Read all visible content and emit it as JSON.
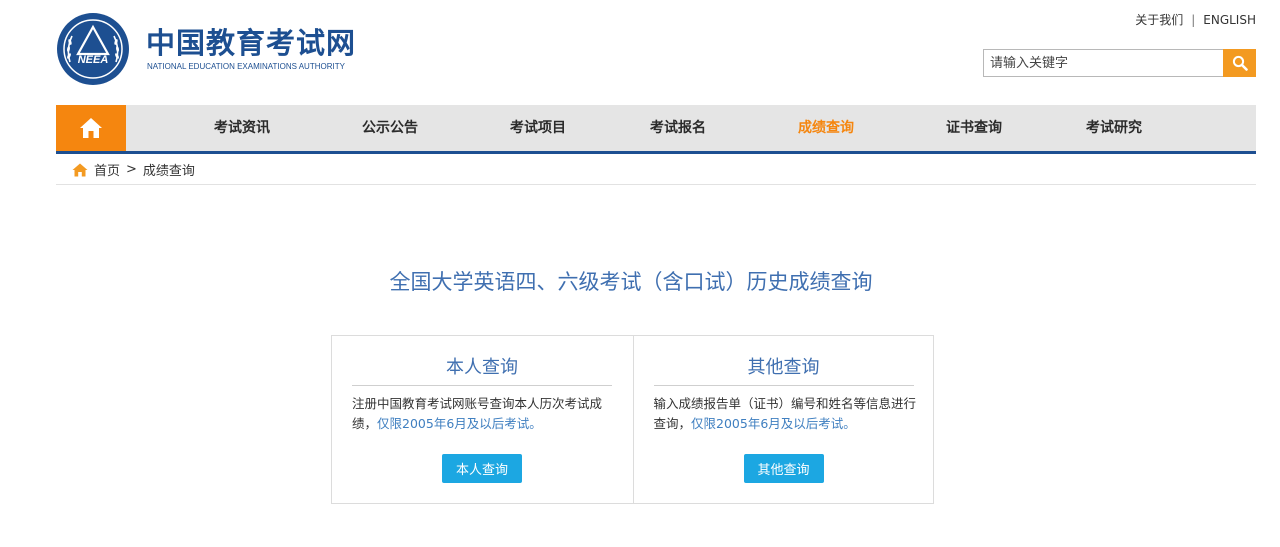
{
  "header": {
    "brand_cn": "中国教育考试网",
    "brand_en": "NATIONAL EDUCATION EXAMINATIONS AUTHORITY",
    "logo_text": "NEEA",
    "about_link": "关于我们",
    "separator": "|",
    "english_link": "ENGLISH",
    "search_placeholder": "请输入关键字",
    "search_icon": "search-icon",
    "brand_color": "#1d4f91",
    "accent_color": "#f5860f"
  },
  "nav": {
    "home_icon": "home-icon",
    "items": [
      {
        "label": "考试资讯",
        "active": false
      },
      {
        "label": "公示公告",
        "active": false
      },
      {
        "label": "考试项目",
        "active": false
      },
      {
        "label": "考试报名",
        "active": false
      },
      {
        "label": "成绩查询",
        "active": true
      },
      {
        "label": "证书查询",
        "active": false
      },
      {
        "label": "考试研究",
        "active": false
      }
    ]
  },
  "breadcrumb": {
    "home_icon": "home-icon",
    "home": "首页",
    "separator": ">",
    "current": "成绩查询"
  },
  "main": {
    "title": "全国大学英语四、六级考试（含口试）历史成绩查询",
    "cards": [
      {
        "title": "本人查询",
        "desc_prefix": "注册中国教育考试网账号查询本人历次考试成绩，",
        "desc_highlight": "仅限2005年6月及以后考试。",
        "button": "本人查询"
      },
      {
        "title": "其他查询",
        "desc_prefix": "输入成绩报告单（证书）编号和姓名等信息进行查询，",
        "desc_highlight": "仅限2005年6月及以后考试。",
        "button": "其他查询"
      }
    ]
  }
}
